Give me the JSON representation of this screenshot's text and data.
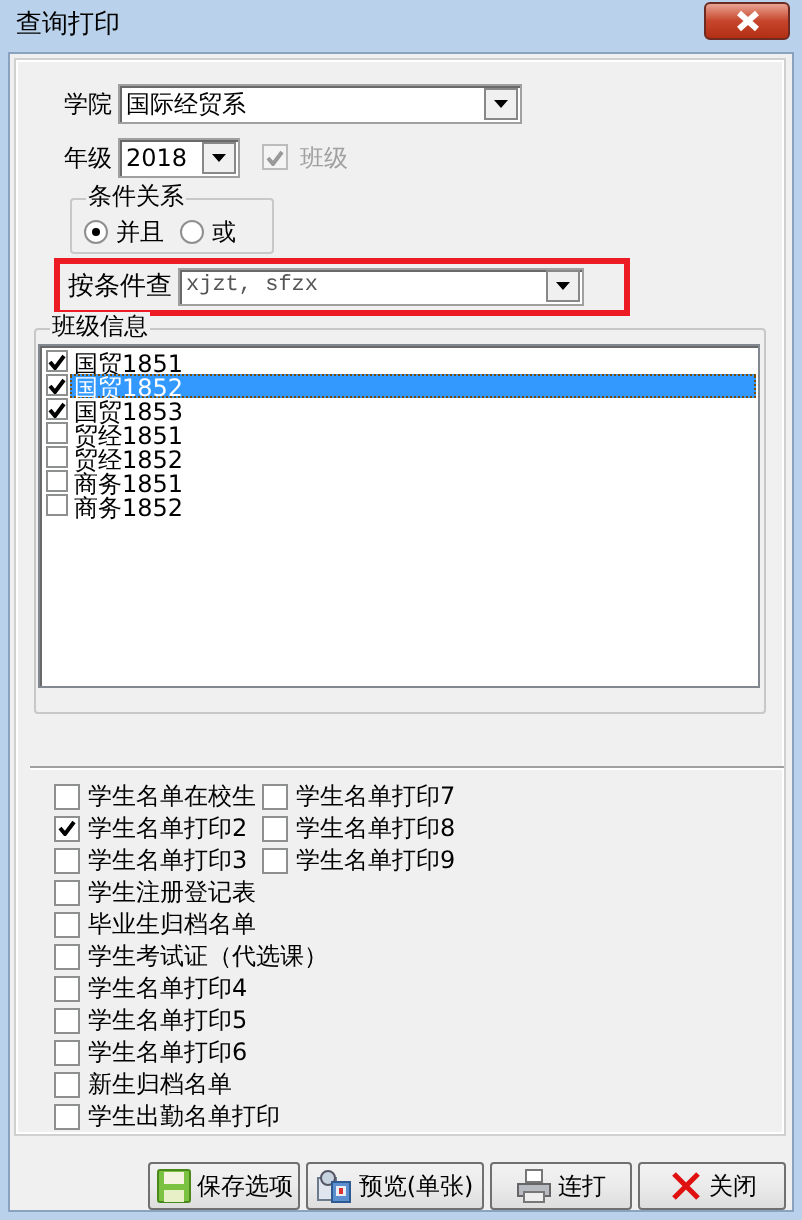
{
  "window": {
    "title": "查询打印"
  },
  "college": {
    "label": "学院",
    "value": "国际经贸系"
  },
  "grade": {
    "label": "年级",
    "value": "2018"
  },
  "class_checkbox": {
    "label": "班级",
    "checked": true,
    "disabled": true
  },
  "condition_relation": {
    "title": "条件关系",
    "options": [
      {
        "label": "并且",
        "selected": true
      },
      {
        "label": "或",
        "selected": false
      }
    ]
  },
  "query_by_condition": {
    "label": "按条件查",
    "value": "xjzt, sfzx",
    "highlighted": true
  },
  "class_info": {
    "title": "班级信息",
    "items": [
      {
        "label": "国贸1851",
        "checked": true,
        "selected": false
      },
      {
        "label": "国贸1852",
        "checked": true,
        "selected": true
      },
      {
        "label": "国贸1853",
        "checked": true,
        "selected": false
      },
      {
        "label": "贸经1851",
        "checked": false,
        "selected": false
      },
      {
        "label": "贸经1852",
        "checked": false,
        "selected": false
      },
      {
        "label": "商务1851",
        "checked": false,
        "selected": false
      },
      {
        "label": "商务1852",
        "checked": false,
        "selected": false
      }
    ]
  },
  "report_options_left": [
    {
      "label": "学生名单在校生",
      "checked": false
    },
    {
      "label": "学生名单打印2",
      "checked": true
    },
    {
      "label": "学生名单打印3",
      "checked": false
    },
    {
      "label": "学生注册登记表",
      "checked": false
    },
    {
      "label": "毕业生归档名单",
      "checked": false
    },
    {
      "label": "学生考试证（代选课）",
      "checked": false
    },
    {
      "label": "学生名单打印4",
      "checked": false
    },
    {
      "label": "学生名单打印5",
      "checked": false
    },
    {
      "label": "学生名单打印6",
      "checked": false
    },
    {
      "label": "新生归档名单",
      "checked": false
    },
    {
      "label": "学生出勤名单打印",
      "checked": false
    }
  ],
  "report_options_right": [
    {
      "label": "学生名单打印7",
      "checked": false
    },
    {
      "label": "学生名单打印8",
      "checked": false
    },
    {
      "label": "学生名单打印9",
      "checked": false
    }
  ],
  "buttons": [
    {
      "label": "保存选项",
      "kind": "save"
    },
    {
      "label": "预览(单张)",
      "kind": "preview"
    },
    {
      "label": "连打",
      "kind": "print"
    },
    {
      "label": "关闭",
      "kind": "close"
    }
  ]
}
